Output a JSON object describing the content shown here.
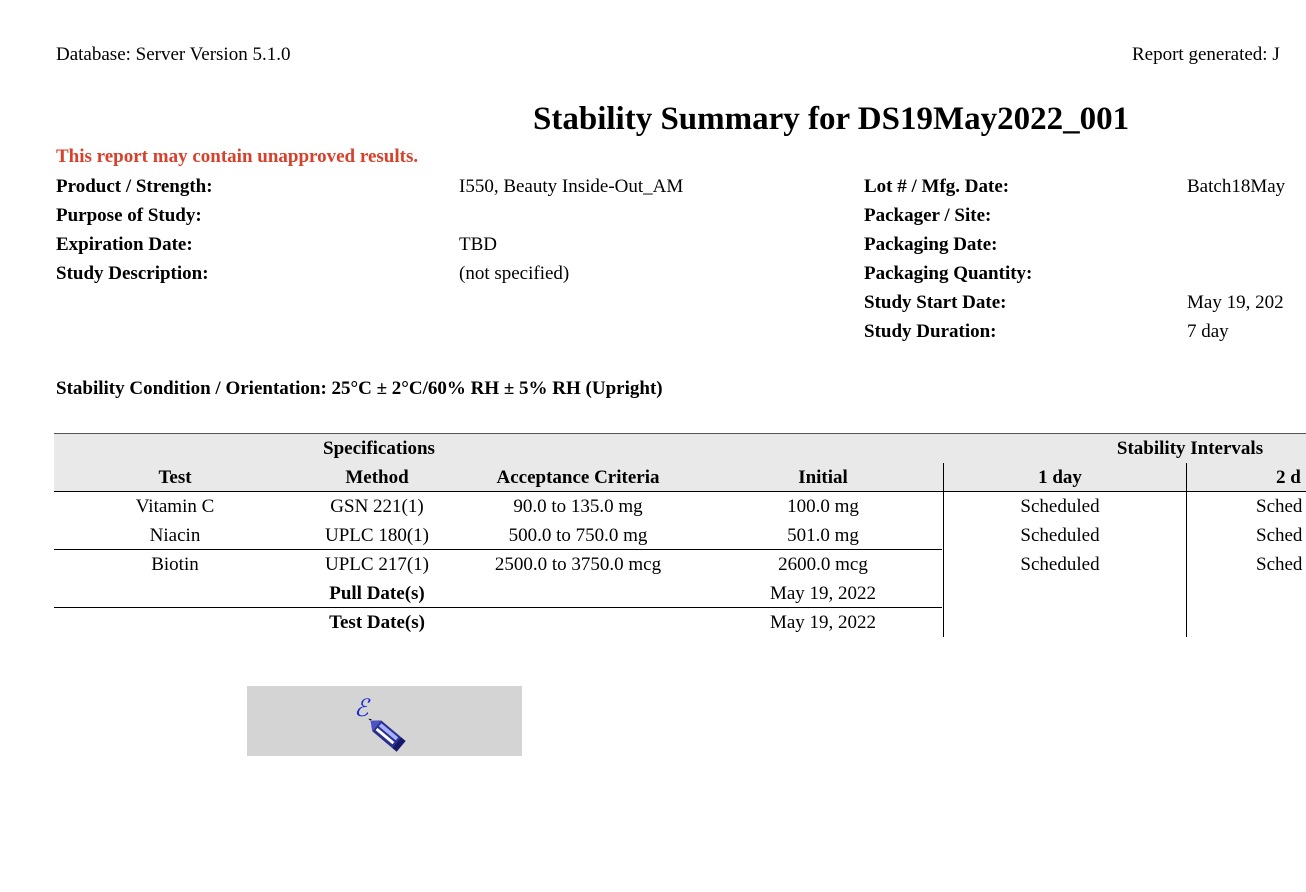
{
  "header": {
    "database": "Database: Server Version 5.1.0",
    "report_generated": "Report generated: J"
  },
  "title": "Stability Summary for DS19May2022_001",
  "warning": "This report may contain unapproved results.",
  "left_fields": [
    {
      "label": "Product / Strength:",
      "value": "I550, Beauty Inside-Out_AM"
    },
    {
      "label": "Purpose of Study:",
      "value": ""
    },
    {
      "label": "Expiration Date:",
      "value": "TBD"
    },
    {
      "label": "Study Description:",
      "value": "(not specified)"
    }
  ],
  "right_fields": [
    {
      "label": "Lot # / Mfg. Date:",
      "value": "Batch18May"
    },
    {
      "label": "Packager / Site:",
      "value": ""
    },
    {
      "label": "Packaging Date:",
      "value": ""
    },
    {
      "label": "Packaging Quantity:",
      "value": ""
    },
    {
      "label": "Study Start Date:",
      "value": "May 19, 202"
    },
    {
      "label": "Study Duration:",
      "value": "7 day"
    }
  ],
  "condition": "Stability Condition / Orientation: 25°C ± 2°C/60% RH ± 5% RH (Upright)",
  "table": {
    "group_headers": {
      "specifications": "Specifications",
      "stability_intervals": "Stability Intervals"
    },
    "columns": {
      "test": "Test",
      "method": "Method",
      "acceptance": "Acceptance Criteria",
      "initial": "Initial",
      "interval_1": "1 day",
      "interval_2": "2 d"
    },
    "rows": [
      {
        "test": "Vitamin C",
        "method": "GSN 221(1)",
        "acceptance": "90.0 to 135.0 mg",
        "initial": "100.0 mg",
        "interval_1": "Scheduled",
        "interval_2": "Sched"
      },
      {
        "test": "Niacin",
        "method": "UPLC 180(1)",
        "acceptance": "500.0 to 750.0 mg",
        "initial": "501.0 mg",
        "interval_1": "Scheduled",
        "interval_2": "Sched"
      },
      {
        "test": "Biotin",
        "method": "UPLC 217(1)",
        "acceptance": "2500.0 to 3750.0 mcg",
        "initial": "2600.0 mcg",
        "interval_1": "Scheduled",
        "interval_2": "Sched"
      }
    ],
    "pull_dates": {
      "label": "Pull Date(s)",
      "initial": "May 19, 2022"
    },
    "test_dates": {
      "label": "Test Date(s)",
      "initial": "May 19, 2022"
    }
  },
  "signature": {
    "icon": "e-signature-pen-icon"
  }
}
